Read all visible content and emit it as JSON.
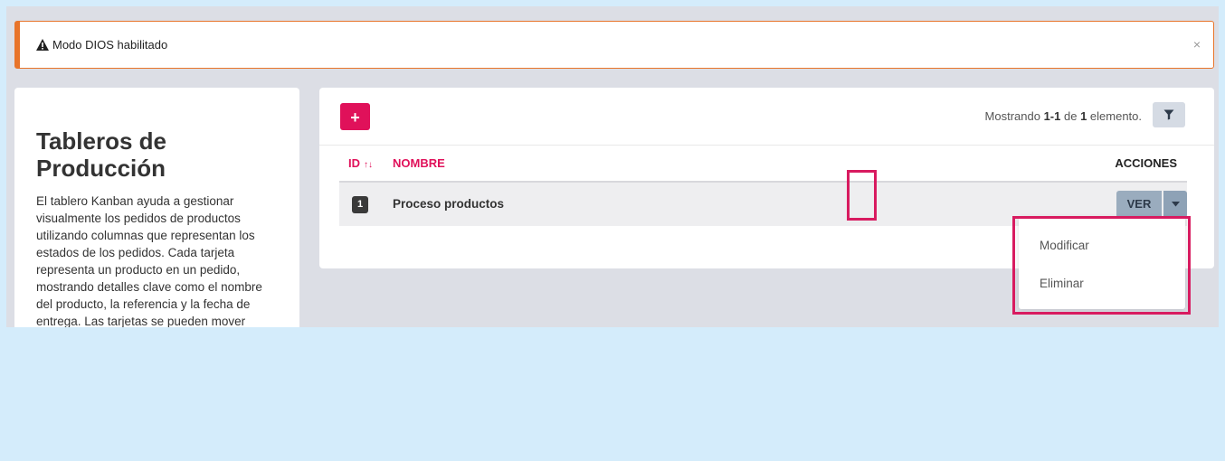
{
  "alert": {
    "text": "Modo DIOS habilitado",
    "close": "×",
    "accent": "#e8742a"
  },
  "side": {
    "title": "Tableros de Producción",
    "description": "El tablero Kanban ayuda a gestionar visualmente los pedidos de productos utilizando columnas que representan los estados de los pedidos. Cada tarjeta representa un producto en un pedido, mostrando detalles clave como el nombre del producto, la referencia y la fecha de entrega. Las tarjetas se pueden mover"
  },
  "toolbar": {
    "add_label": "+",
    "showing_prefix": "Mostrando ",
    "showing_range": "1-1",
    "showing_mid": " de ",
    "showing_total": "1",
    "showing_suffix": " elemento.",
    "filter_icon": "filter-icon"
  },
  "table": {
    "columns": {
      "id": "ID",
      "name": "NOMBRE",
      "actions": "ACCIONES"
    },
    "rows": [
      {
        "id": "1",
        "name": "Proceso productos",
        "view_label": "VER"
      }
    ]
  },
  "dropdown": {
    "items": [
      {
        "label": "Modificar"
      },
      {
        "label": "Eliminar"
      }
    ]
  },
  "colors": {
    "brand": "#e0115a",
    "highlight": "#d81b60",
    "button_gray": "#9aacbe"
  }
}
